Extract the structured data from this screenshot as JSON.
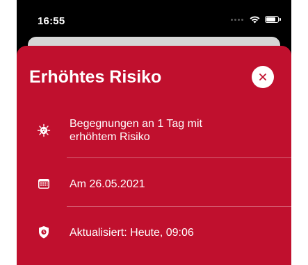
{
  "status_bar": {
    "time": "16:55",
    "battery_level": 0.85
  },
  "sheet": {
    "title": "Erhöhtes Risiko",
    "background_color": "#c0102e",
    "close_icon": "close-icon",
    "rows": [
      {
        "icon": "virus-icon",
        "line1": "Begegnungen an 1 Tag mit",
        "line2": "erhöhtem Risiko"
      },
      {
        "icon": "calendar-icon",
        "text": "Am 26.05.2021"
      },
      {
        "icon": "shield-clock-icon",
        "text": "Aktualisiert: Heute, 09:06"
      }
    ]
  }
}
